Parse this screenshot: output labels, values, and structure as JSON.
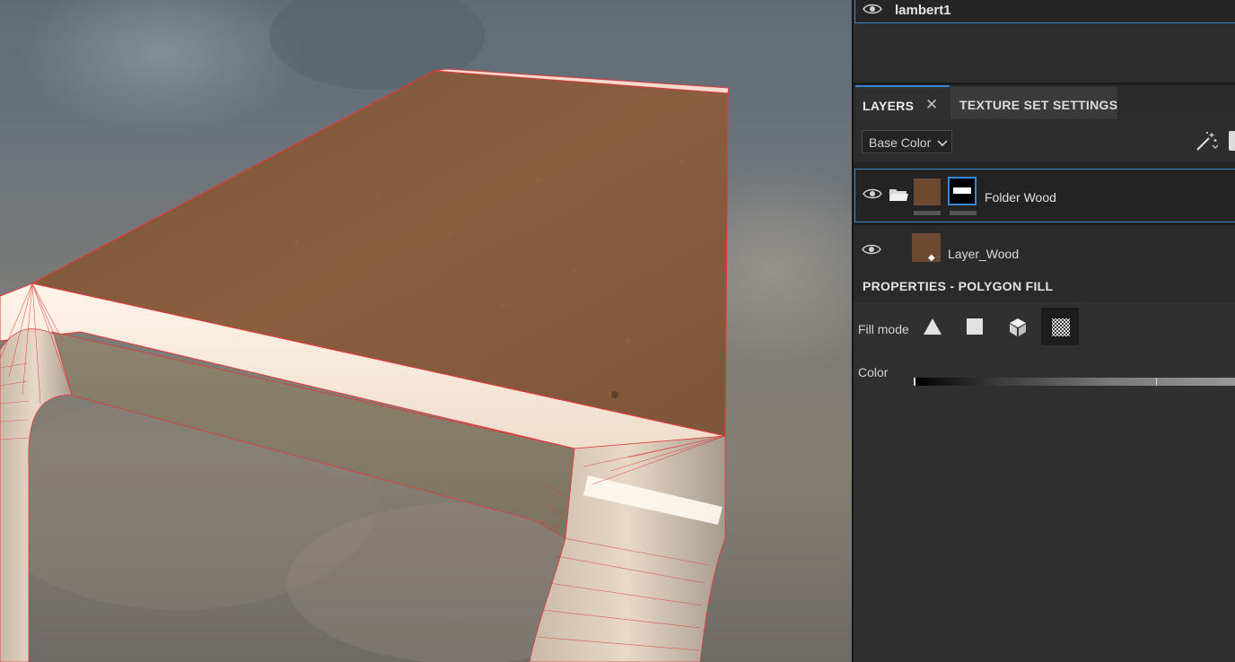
{
  "material_list": {
    "item_label": "lambert1"
  },
  "tabs": {
    "layers": "LAYERS",
    "close_glyph": "✕",
    "texture_set_settings": "TEXTURE SET SETTINGS"
  },
  "channel_select": {
    "value": "Base Color"
  },
  "layers": [
    {
      "name": "Folder Wood",
      "type": "folder",
      "visible": true,
      "selected": true
    },
    {
      "name": "Layer_Wood",
      "type": "fill",
      "visible": true,
      "selected": false
    }
  ],
  "properties": {
    "header": "PROPERTIES - POLYGON FILL",
    "fill_mode_label": "Fill mode",
    "fill_modes": [
      "triangle-fill-icon",
      "quad-fill-icon",
      "mesh-fill-icon",
      "uv-chunk-fill-icon"
    ],
    "active_fill_mode": "uv-chunk-fill-icon",
    "color_label": "Color"
  },
  "colors": {
    "accent": "#3b86d1",
    "wood": "#6b4a31",
    "wireframe": "#e03a3a"
  }
}
